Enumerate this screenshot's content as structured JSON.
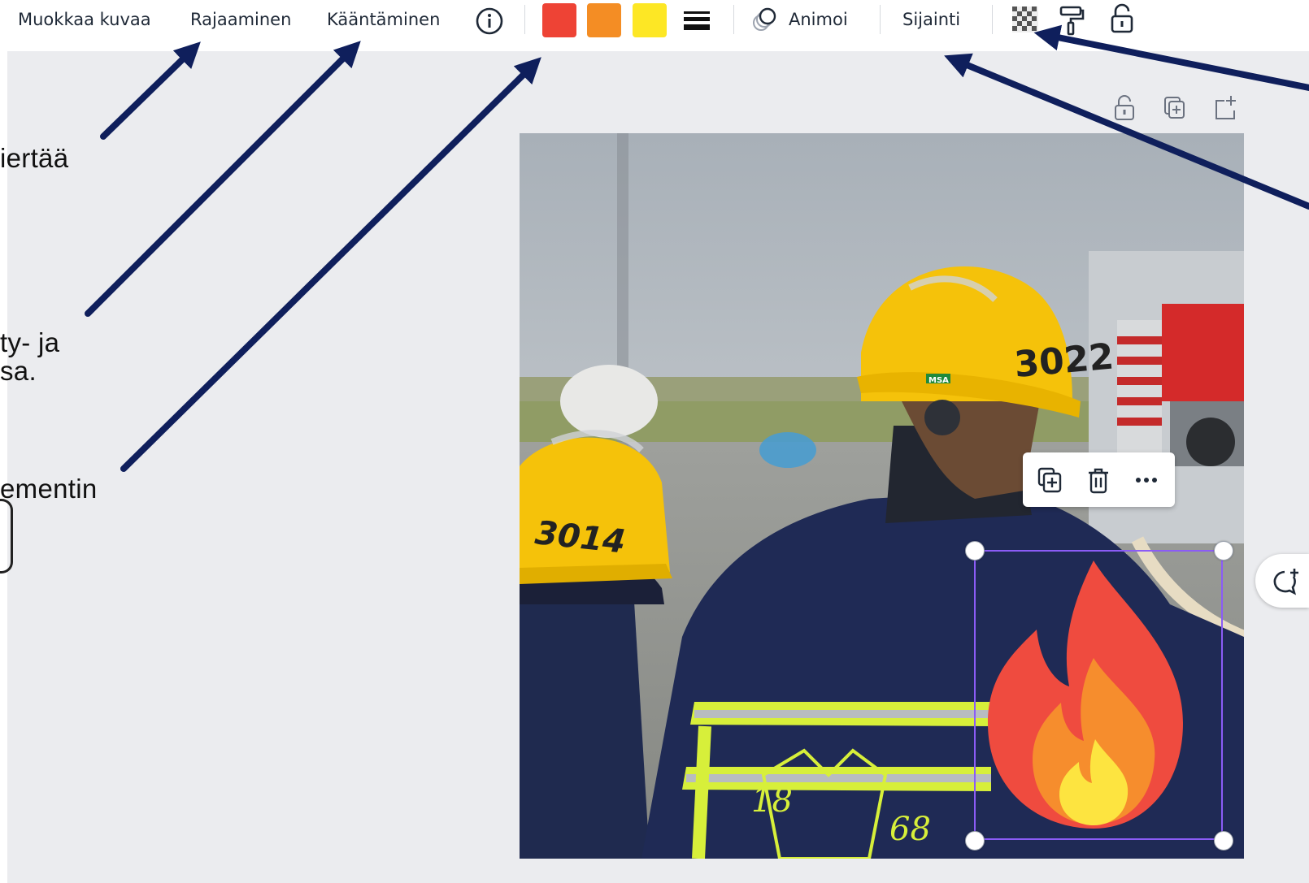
{
  "toolbar": {
    "edit_image": "Muokkaa kuvaa",
    "crop": "Rajaaminen",
    "flip": "Kääntäminen",
    "info_icon": "info-icon",
    "swatches": [
      "#ee4335",
      "#f48d24",
      "#fde725"
    ],
    "line_weight_icon": "lines-icon",
    "animate": "Animoi",
    "position": "Sijainti",
    "transparency_icon": "checkerboard-icon",
    "paint_roller_icon": "paint-roller-icon",
    "lock_icon": "lock-icon"
  },
  "callouts": {
    "c1": "iertää",
    "c2_line1": "ty- ja",
    "c2_line2": "sa.",
    "c3": "ementin"
  },
  "page_actions": {
    "lock_icon": "lock-icon",
    "duplicate_icon": "duplicate-page-icon",
    "add_icon": "add-page-icon"
  },
  "photo": {
    "helmet_left_number": "3014",
    "helmet_right_number": "3022",
    "helmet_brand": "MSA",
    "jacket_year_left": "18",
    "jacket_year_right": "68"
  },
  "context_menu": {
    "duplicate_icon": "copy-icon",
    "delete_icon": "trash-icon",
    "more_icon": "more-icon"
  },
  "comment_icon": "add-comment-icon",
  "colors": {
    "arrow": "#0f1f5c",
    "selection": "#8b5cf6",
    "editor_bg": "#ebecef"
  }
}
